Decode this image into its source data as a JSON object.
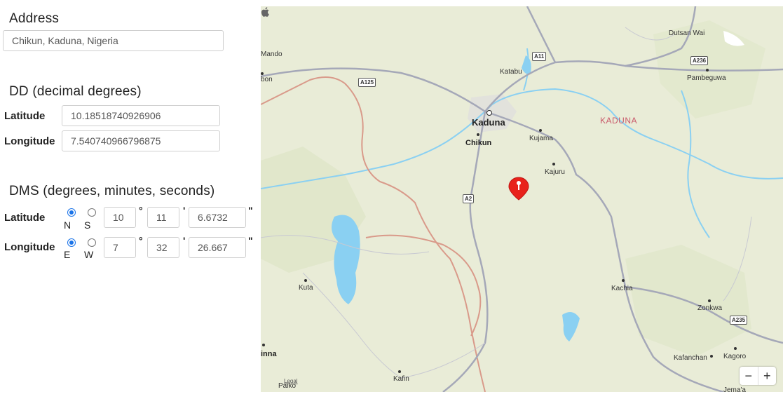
{
  "address": {
    "label": "Address",
    "value": "Chikun, Kaduna, Nigeria"
  },
  "dd": {
    "title": "DD (decimal degrees)",
    "latitude_label": "Latitude",
    "latitude_value": "10.18518740926906",
    "longitude_label": "Longitude",
    "longitude_value": "7.540740966796875"
  },
  "dms": {
    "title": "DMS (degrees, minutes, seconds)",
    "latitude_label": "Latitude",
    "lat_north": "N",
    "lat_south": "S",
    "lat_hemisphere_selected": "N",
    "lat_degrees": "10",
    "lat_minutes": "11",
    "lat_seconds": "6.6732",
    "longitude_label": "Longitude",
    "lon_east": "E",
    "lon_west": "W",
    "lon_hemisphere_selected": "E",
    "lon_degrees": "7",
    "lon_minutes": "32",
    "lon_seconds": "26.667",
    "degree_symbol": "°",
    "minute_symbol": "'",
    "second_symbol": "\""
  },
  "map": {
    "places": {
      "dutsan_wai": "Dutsan Wai",
      "mando": "Mando",
      "bon": "bon",
      "katabu": "Katabu",
      "pambeguwa": "Pambeguwa",
      "kaduna": "Kaduna",
      "chikun": "Chikun",
      "kujama": "Kujama",
      "kajuru": "Kajuru",
      "kuta": "Kuta",
      "kachia": "Kachia",
      "zonkwa": "Zonkwa",
      "kafanchan": "Kafanchan",
      "kagoro": "Kagoro",
      "kafin": "Kafin",
      "paiko": "Paiko",
      "inna": "inna",
      "jemaa": "Jema'a"
    },
    "region_label": "KADUNA",
    "road_shields": {
      "a11": "A11",
      "a236": "A236",
      "a125": "A125",
      "a2": "A2",
      "a235": "A235"
    },
    "legal": "Legal",
    "zoom_out": "−",
    "zoom_in": "+",
    "colors": {
      "land": "#e9ecd7",
      "water": "#8ad0f2",
      "road": "#a5a8b8",
      "border": "#d99a8a",
      "pin": "#e8221b"
    }
  }
}
